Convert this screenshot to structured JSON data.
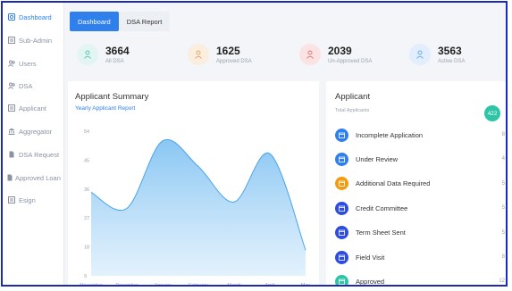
{
  "sidebar": {
    "items": [
      {
        "label": "Dashboard",
        "icon": "dashboard-icon",
        "active": true
      },
      {
        "label": "Sub-Admin",
        "icon": "list-icon"
      },
      {
        "label": "Users",
        "icon": "users-icon"
      },
      {
        "label": "DSA",
        "icon": "users-icon"
      },
      {
        "label": "Applicant",
        "icon": "list-icon"
      },
      {
        "label": "Aggregator",
        "icon": "bank-icon"
      },
      {
        "label": "DSA Request",
        "icon": "document-icon"
      },
      {
        "label": "Approved Loan",
        "icon": "document-icon"
      },
      {
        "label": "Esign",
        "icon": "list-icon"
      }
    ]
  },
  "tabs": [
    {
      "label": "Dashboard",
      "active": true
    },
    {
      "label": "DSA Report",
      "active": false
    }
  ],
  "stats": [
    {
      "value": "3664",
      "label": "All DSA",
      "color": "#5fc6b8",
      "bg": "#e3f5f2"
    },
    {
      "value": "1625",
      "label": "Approved DSA",
      "color": "#e0a86a",
      "bg": "#fbeedf"
    },
    {
      "value": "2039",
      "label": "Un-Approved DSA",
      "color": "#e07b7b",
      "bg": "#fbe3e3"
    },
    {
      "value": "3563",
      "label": "Active DSA",
      "color": "#6aaee8",
      "bg": "#e2eefb"
    }
  ],
  "summary": {
    "title": "Applicant Summary",
    "subtitle": "Yearly Applicant Report"
  },
  "chart_data": {
    "type": "area",
    "title": "Applicant Summary",
    "subtitle": "Yearly Applicant Report",
    "categories": [
      "November",
      "December",
      "January",
      "February",
      "March",
      "April",
      "May"
    ],
    "y_ticks": [
      "54",
      "45",
      "36",
      "27",
      "18",
      "9"
    ],
    "ylim": [
      9,
      54
    ],
    "series": [
      {
        "values": [
          35,
          30,
          51,
          43,
          32,
          47,
          17
        ]
      }
    ],
    "grid": false,
    "color": "#7cc0f2"
  },
  "applicant": {
    "title": "Applicant",
    "subtitle": "Total Applicants",
    "total": "422",
    "items": [
      {
        "label": "Incomplete Application",
        "count": "8",
        "color": "#2f80ed"
      },
      {
        "label": "Under Review",
        "count": "4",
        "color": "#2f80ed"
      },
      {
        "label": "Additional Data Required",
        "count": "5",
        "color": "#f39c12"
      },
      {
        "label": "Credit Committee",
        "count": "5",
        "color": "#2d4de0"
      },
      {
        "label": "Term Sheet Sent",
        "count": "5",
        "color": "#2d4de0"
      },
      {
        "label": "Field Visit",
        "count": "8",
        "color": "#2d4de0"
      },
      {
        "label": "Approved",
        "count": "12",
        "color": "#2ec4a6"
      }
    ]
  }
}
